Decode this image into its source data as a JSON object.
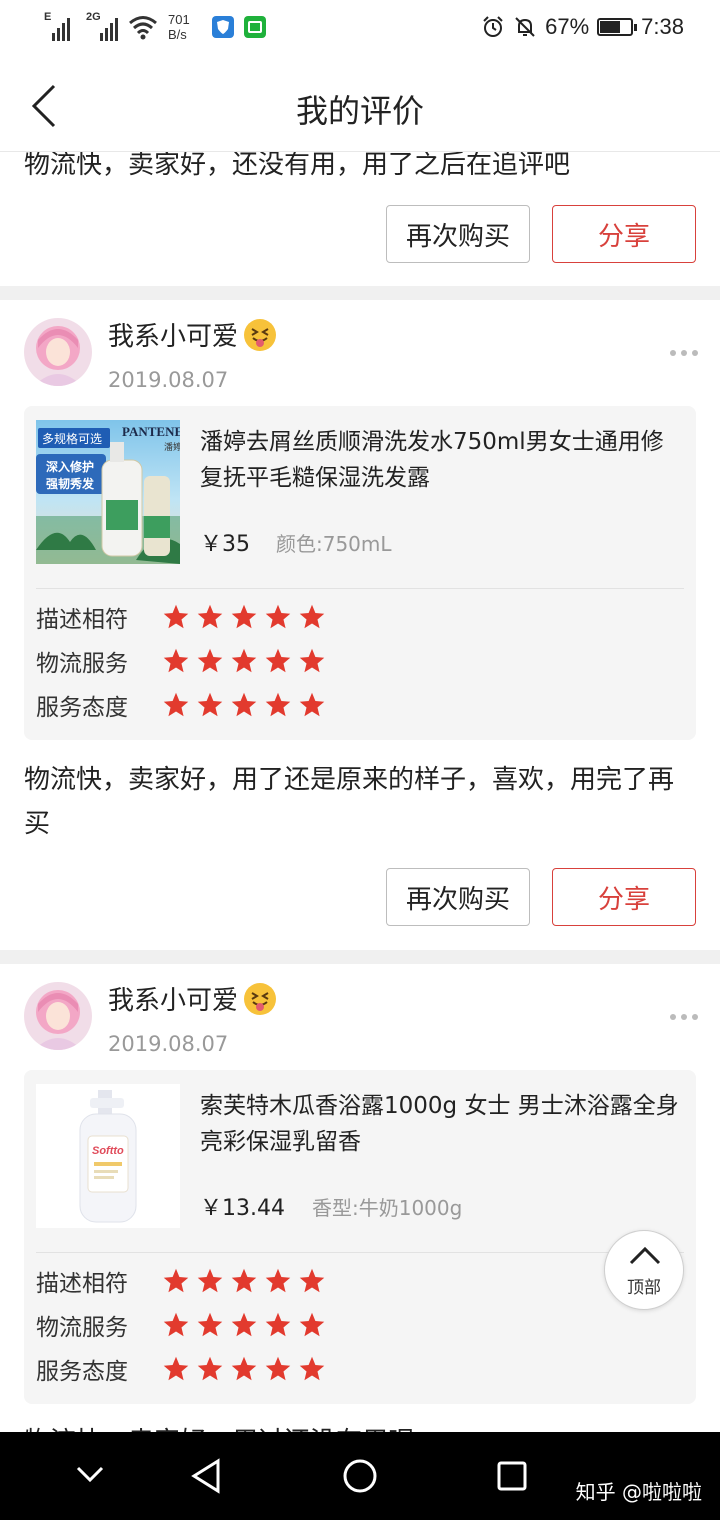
{
  "status_bar": {
    "signal1_label": "E",
    "signal2_label": "2G",
    "net_speed_value": "701",
    "net_speed_unit": "B/s",
    "battery": "67%",
    "battery_level": 0.67,
    "time": "7:38"
  },
  "header": {
    "title": "我的评价",
    "back_icon": "chevron-left-icon"
  },
  "partial_review": {
    "text": "物流快，卖家好，还没有用，用了之后在追评吧",
    "rebuy_label": "再次购买",
    "share_label": "分享"
  },
  "reviews": [
    {
      "user": "我系小可爱",
      "date": "2019.08.07",
      "product": {
        "name": "潘婷去屑丝质顺滑洗发水750ml男女士通用修复抚平毛糙保湿洗发露",
        "price": "￥35",
        "spec": "颜色:750mL",
        "thumb_badge": "多规格可选",
        "thumb_brand": "PANTENE",
        "thumb_brand_cn": "潘婷",
        "thumb_line1": "深入修护",
        "thumb_line2": "强韧秀发"
      },
      "ratings": [
        {
          "label": "描述相符",
          "stars": 5
        },
        {
          "label": "物流服务",
          "stars": 5
        },
        {
          "label": "服务态度",
          "stars": 5
        }
      ],
      "text": "物流快，卖家好，用了还是原来的样子，喜欢，用完了再买",
      "rebuy_label": "再次购买",
      "share_label": "分享"
    },
    {
      "user": "我系小可爱",
      "date": "2019.08.07",
      "product": {
        "name": "索芙特木瓜香浴露1000g 女士 男士沐浴露全身亮彩保湿乳留香",
        "price": "￥13.44",
        "spec": "香型:牛奶1000g",
        "thumb_brand": "Softto"
      },
      "ratings": [
        {
          "label": "描述相符",
          "stars": 5
        },
        {
          "label": "物流服务",
          "stars": 5
        },
        {
          "label": "服务态度",
          "stars": 5
        }
      ],
      "text": "物流快，卖家好，用过还没有用呢"
    }
  ],
  "top_button": {
    "label": "顶部",
    "icon": "chevron-up-icon"
  },
  "nav_bar": {
    "icons": [
      "chevron-down-icon",
      "back-triangle-icon",
      "home-circle-icon",
      "recents-square-icon"
    ],
    "watermark": "知乎 @啦啦啦"
  },
  "colors": {
    "accent": "#d8413c",
    "star": "#e23a2e",
    "card_bg": "#f5f5f5",
    "gap_bg": "#f0f0f0"
  }
}
